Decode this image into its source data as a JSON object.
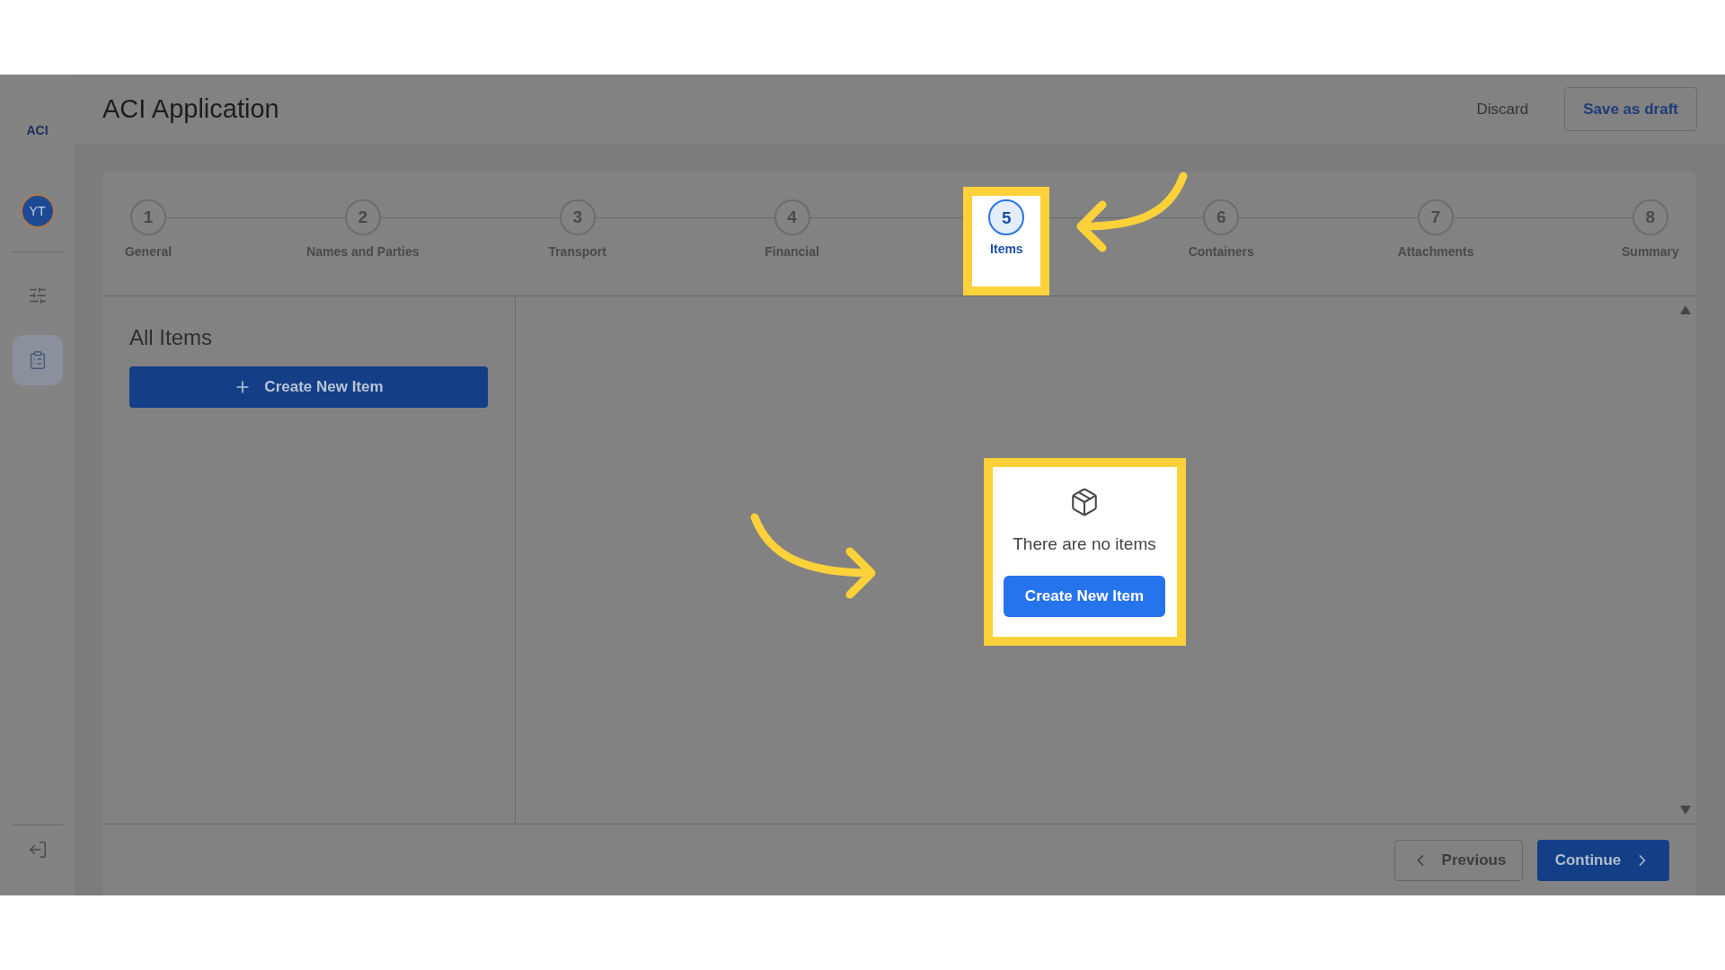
{
  "sidebar": {
    "logo": "ACI",
    "avatar": "YT",
    "items": [
      {
        "kind": "sliders",
        "selected": false
      },
      {
        "kind": "clipboard",
        "selected": true
      }
    ]
  },
  "header": {
    "title": "ACI Application",
    "discard": "Discard",
    "save": "Save as draft"
  },
  "steps": [
    {
      "number": "1",
      "label": "General",
      "selected": false,
      "highlighted": false
    },
    {
      "number": "2",
      "label": "Names and Parties",
      "selected": false,
      "highlighted": false
    },
    {
      "number": "3",
      "label": "Transport",
      "selected": false,
      "highlighted": false
    },
    {
      "number": "4",
      "label": "Financial",
      "selected": false,
      "highlighted": false
    },
    {
      "number": "5",
      "label": "Items",
      "selected": true,
      "highlighted": true
    },
    {
      "number": "6",
      "label": "Containers",
      "selected": false,
      "highlighted": false
    },
    {
      "number": "7",
      "label": "Attachments",
      "selected": false,
      "highlighted": false
    },
    {
      "number": "8",
      "label": "Summary",
      "selected": false,
      "highlighted": false
    }
  ],
  "items_panel": {
    "title": "All Items",
    "create_button": "Create New Item"
  },
  "empty_state": {
    "message": "There are no items",
    "button": "Create New Item",
    "highlighted": true
  },
  "footer": {
    "previous": "Previous",
    "continue": "Continue"
  }
}
